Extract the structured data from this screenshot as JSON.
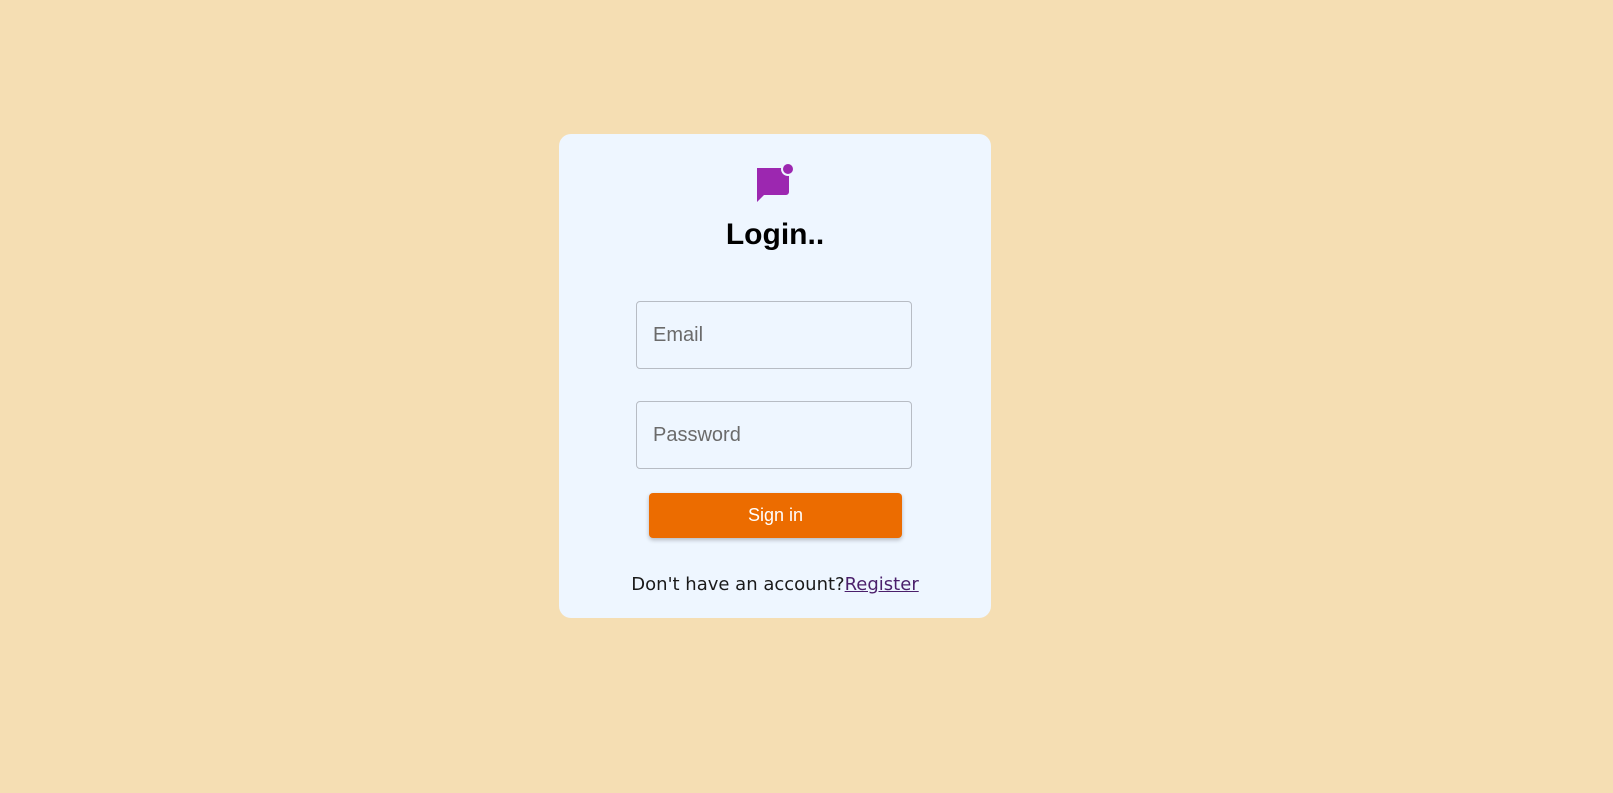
{
  "colors": {
    "page_background": "#f5deb3",
    "card_background": "#eef6ff",
    "accent": "#9c27b0",
    "button": "#ec6c00",
    "link": "#4b1f6b"
  },
  "logo": {
    "icon": "chat-notification-icon"
  },
  "login": {
    "title": "Login..",
    "email_placeholder": "Email",
    "email_value": "",
    "password_placeholder": "Password",
    "password_value": "",
    "signin_label": "Sign in",
    "no_account_text": "Don't have an account?",
    "register_label": "Register"
  }
}
